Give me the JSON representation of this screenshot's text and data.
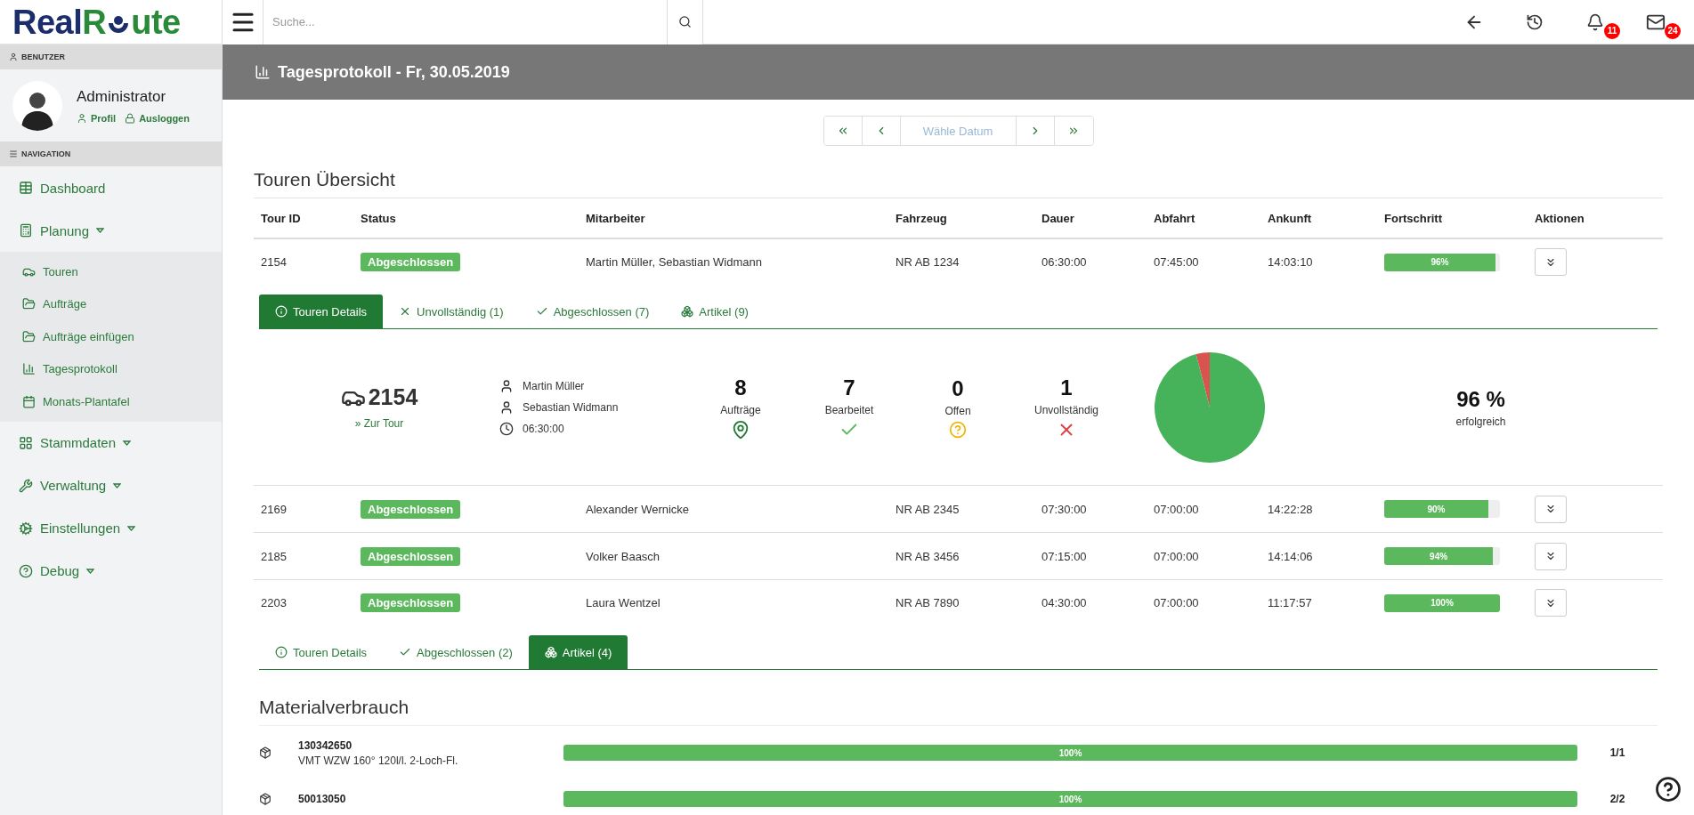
{
  "logo": {
    "part_a": "Real",
    "part_b": "R",
    "part_c": "ute"
  },
  "header": {
    "search": {
      "placeholder": "Suche..."
    },
    "notifications_badge": "11",
    "messages_badge": "24"
  },
  "sidebar": {
    "user_heading": "BENUTZER",
    "user": {
      "name": "Administrator",
      "links": [
        "Profil",
        "Ausloggen"
      ]
    },
    "nav_heading": "NAVIGATION",
    "items": [
      {
        "label": "Dashboard",
        "expandable": false
      },
      {
        "label": "Planung",
        "expandable": true,
        "children": [
          {
            "label": "Touren"
          },
          {
            "label": "Aufträge"
          },
          {
            "label": "Aufträge einfügen"
          },
          {
            "label": "Tagesprotokoll"
          },
          {
            "label": "Monats-Plantafel"
          }
        ]
      },
      {
        "label": "Stammdaten",
        "expandable": true
      },
      {
        "label": "Verwaltung",
        "expandable": true
      },
      {
        "label": "Einstellungen",
        "expandable": true
      },
      {
        "label": "Debug",
        "expandable": true
      }
    ]
  },
  "page_title": "Tagesprotokoll - Fr, 30.05.2019",
  "date_picker": {
    "placeholder": "Wähle Datum"
  },
  "section_title": "Touren Übersicht",
  "table": {
    "columns": [
      "Tour ID",
      "Status",
      "Mitarbeiter",
      "Fahrzeug",
      "Dauer",
      "Abfahrt",
      "Ankunft",
      "Fortschritt",
      "Aktionen"
    ],
    "rows": [
      {
        "tour_id": "2154",
        "status": "Abgeschlossen",
        "employees": "Martin Müller, Sebastian Widmann",
        "vehicle": "NR AB 1234",
        "duration": "06:30:00",
        "departure": "07:45:00",
        "arrival": "14:03:10",
        "level": 0.96,
        "reading": "96%",
        "expanded": true,
        "detail": {
          "tabs": [
            {
              "label": "Touren Details",
              "kind": "info",
              "selected": true
            },
            {
              "label": "Unvollständig (1)",
              "kind": "incomplete",
              "selected": false
            },
            {
              "label": "Abgeschlossen (7)",
              "kind": "done",
              "selected": false
            },
            {
              "label": "Artikel (9)",
              "kind": "articles",
              "selected": false
            }
          ],
          "panel": {
            "tour_id": "2154",
            "link": "» Zur Tour",
            "employees": [
              "Martin Müller",
              "Sebastian Widmann"
            ],
            "duration": "06:30:00",
            "stats": [
              {
                "value": "8",
                "label": "Aufträge",
                "kind": "orders"
              },
              {
                "value": "7",
                "label": "Bearbeitet",
                "kind": "done"
              },
              {
                "value": "0",
                "label": "Offen",
                "kind": "open"
              },
              {
                "value": "1",
                "label": "Unvollständig",
                "kind": "incomplete"
              }
            ],
            "pie": {
              "level": 0.96
            },
            "percent": "96 %",
            "percent_label": "erfolgreich"
          }
        }
      },
      {
        "tour_id": "2169",
        "status": "Abgeschlossen",
        "employees": "Alexander Wernicke",
        "vehicle": "NR AB 2345",
        "duration": "07:30:00",
        "departure": "07:00:00",
        "arrival": "14:22:28",
        "level": 0.9,
        "reading": "90%",
        "expanded": false
      },
      {
        "tour_id": "2185",
        "status": "Abgeschlossen",
        "employees": "Volker Baasch",
        "vehicle": "NR AB 3456",
        "duration": "07:15:00",
        "departure": "07:00:00",
        "arrival": "14:14:06",
        "level": 0.94,
        "reading": "94%",
        "expanded": false
      },
      {
        "tour_id": "2203",
        "status": "Abgeschlossen",
        "employees": "Laura Wentzel",
        "vehicle": "NR AB 7890",
        "duration": "04:30:00",
        "departure": "07:00:00",
        "arrival": "11:17:57",
        "level": 1,
        "reading": "100%",
        "expanded": true,
        "detail": {
          "tabs": [
            {
              "label": "Touren Details",
              "kind": "info",
              "selected": false
            },
            {
              "label": "Abgeschlossen (2)",
              "kind": "done",
              "selected": false
            },
            {
              "label": "Artikel (4)",
              "kind": "articles",
              "selected": true
            }
          ],
          "materials": {
            "title": "Materialverbrauch",
            "items": [
              {
                "number": "130342650",
                "description": "VMT WZW 160° 120l/l. 2-Loch-Fl.",
                "level": 1,
                "reading": "100%",
                "count": "1/1"
              },
              {
                "number": "50013050",
                "level": 1,
                "reading": "100%",
                "count": "2/2"
              }
            ]
          }
        }
      }
    ]
  }
}
